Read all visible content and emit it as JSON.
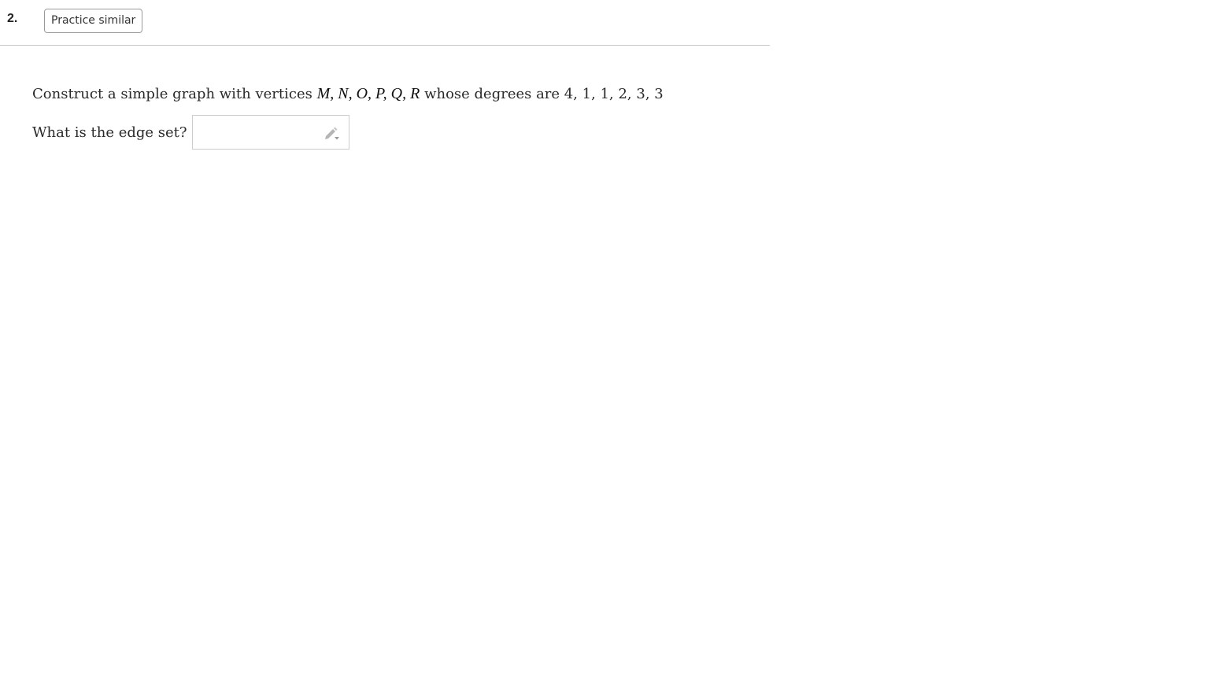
{
  "question": {
    "number": "2.",
    "practice_label": "Practice similar",
    "prompt_prefix": "Construct a simple graph with vertices ",
    "vertices": "M, N, O, P, Q, R",
    "prompt_suffix": " whose degrees are 4, 1, 1, 2, 3, 3",
    "answer_label": "What is the edge set?",
    "answer_value": "",
    "answer_placeholder": ""
  },
  "icons": {
    "answer_tool": "pencil-icon"
  },
  "colors": {
    "text": "#2a2a2a",
    "divider": "#c8c8c8",
    "icon": "#b5b5b5"
  }
}
